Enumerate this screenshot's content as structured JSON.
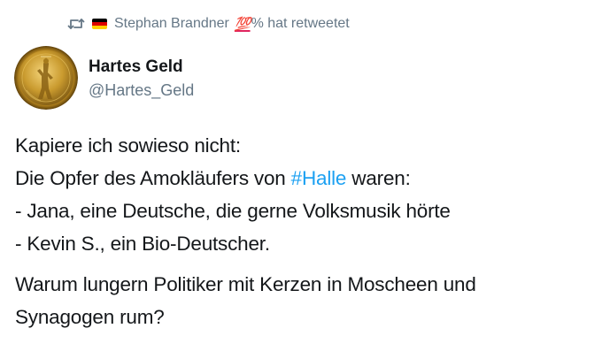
{
  "retweet": {
    "icon": "retweet-icon",
    "flag": "germany-flag",
    "name": "Stephan Brandner",
    "badge": "💯",
    "suffix": "% hat retweetet"
  },
  "tweet": {
    "author": {
      "name": "Hartes Geld",
      "handle": "@Hartes_Geld",
      "avatar": "gold-coin-avatar"
    },
    "paragraph1": {
      "line1": "Kapiere ich sowieso nicht:",
      "line2_before": "Die Opfer des Amokläufers von ",
      "line2_hashtag": "#Halle",
      "line2_after": " waren:",
      "line3": "- Jana, eine Deutsche, die gerne Volksmusik hörte",
      "line4": "- Kevin S., ein Bio-Deutscher."
    },
    "paragraph2": {
      "line1": "Warum lungern Politiker mit Kerzen in Moscheen und",
      "line2": "Synagogen rum?"
    }
  },
  "colors": {
    "text": "#14171a",
    "secondary": "#657786",
    "link": "#1da1f2",
    "badge": "#e0245e"
  }
}
